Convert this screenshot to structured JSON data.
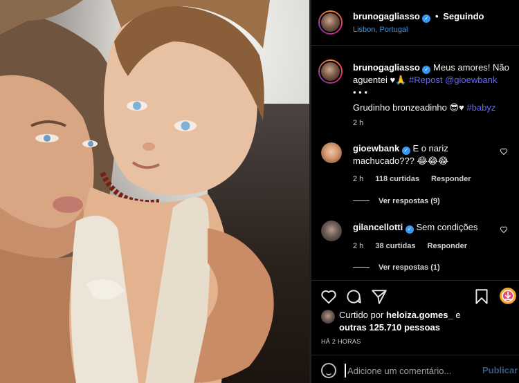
{
  "post": {
    "username": "brunogagliasso",
    "follow_status": "Seguindo",
    "location": "Lisbon, Portugal",
    "caption_lines": [
      "Meus amores! Não",
      "aguentei ♥🙏",
      "• • •",
      "Grudinho bronzeadinho 😎♥"
    ],
    "caption_hashtag": "#babyz",
    "caption_repost": "#Repost @gioewbank",
    "caption_time": "2 h"
  },
  "comments": [
    {
      "username": "gioewbank",
      "text_line1": "E o nariz",
      "text_line2": "machucado??? 😂😂😂",
      "time": "2 h",
      "likes": "118 curtidas",
      "reply_label": "Responder",
      "view_replies": "Ver respostas (9)"
    },
    {
      "username": "gilancellotti",
      "text_line1": "Sem condições",
      "time": "2 h",
      "likes": "38 curtidas",
      "reply_label": "Responder",
      "view_replies": "Ver respostas (1)"
    }
  ],
  "likes": {
    "prefix": "Curtido por",
    "user": "heloiza.gomes_",
    "joiner": "e",
    "others": "outras 125.710 pessoas"
  },
  "timestamp": "HÁ 2 HORAS",
  "comment_box": {
    "placeholder": "Adicione um comentário...",
    "post_label": "Publicar"
  },
  "icons": {
    "like": "heart-icon",
    "comment": "comment-icon",
    "share": "paper-plane-icon",
    "save": "bookmark-icon",
    "download": "download-icon",
    "emoji": "emoji-icon",
    "verified": "verified-badge-icon"
  },
  "colors": {
    "link_blue": "#3897f0",
    "hashtag": "#6666ff",
    "background": "#000000"
  }
}
